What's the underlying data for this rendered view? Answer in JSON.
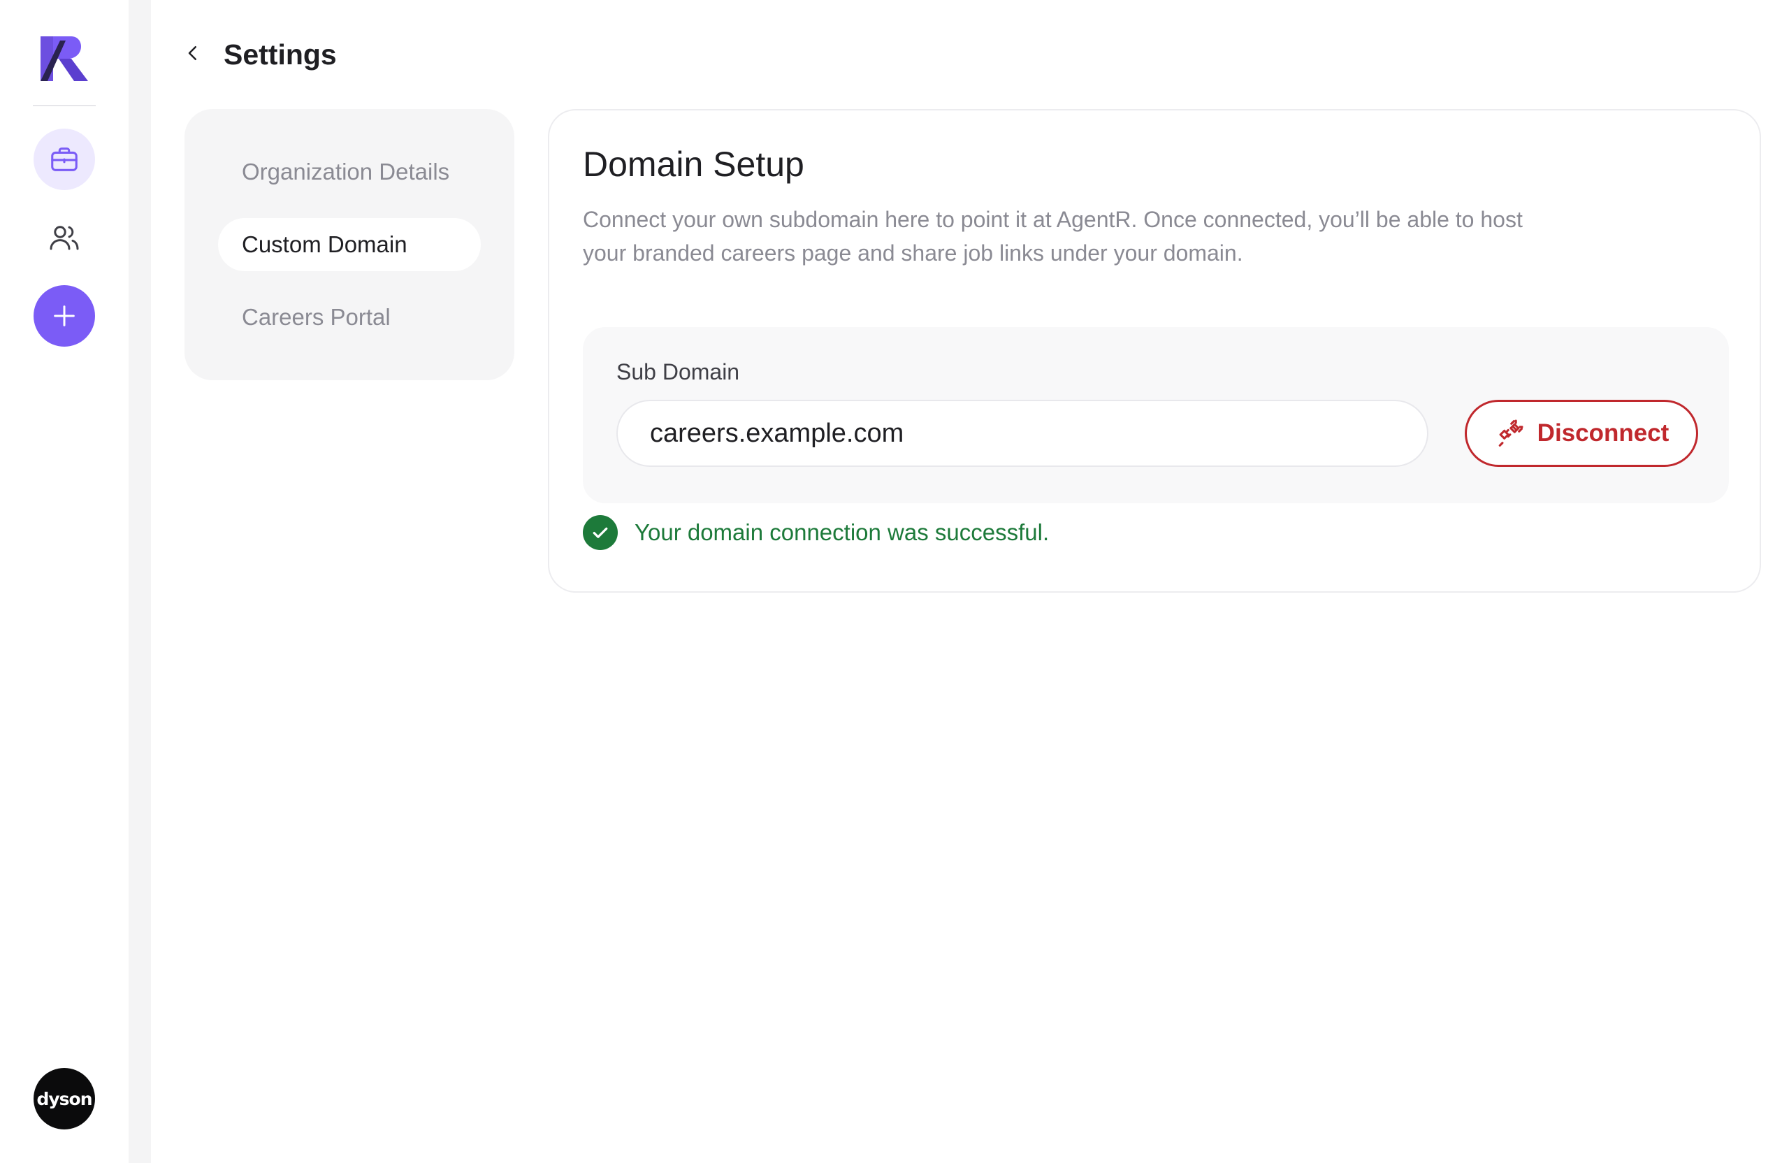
{
  "app": {
    "logo_icon": "agentr-k-logo-icon",
    "brand_color": "#7b5cf6"
  },
  "rail": {
    "items": [
      {
        "name": "jobs",
        "icon": "briefcase-icon",
        "active": true
      },
      {
        "name": "people",
        "icon": "users-icon",
        "active": false
      },
      {
        "name": "add",
        "icon": "plus-icon",
        "active": false
      }
    ],
    "avatar_label": "dyson"
  },
  "header": {
    "back_icon": "chevron-left-icon",
    "title": "Settings"
  },
  "settings_nav": {
    "items": [
      {
        "label": "Organization Details",
        "active": false
      },
      {
        "label": "Custom Domain",
        "active": true
      },
      {
        "label": "Careers Portal",
        "active": false
      }
    ]
  },
  "domain_setup": {
    "title": "Domain Setup",
    "description": "Connect your own subdomain here to point it at AgentR. Once connected, you’ll be able to host your branded careers page and share job links under your domain.",
    "field_label": "Sub Domain",
    "domain_value": "careers.example.com",
    "disconnect_label": "Disconnect",
    "disconnect_icon": "unlink-icon",
    "disconnect_color": "#c0282d",
    "status_icon": "check-circle-icon",
    "status_text": "Your domain connection was successful.",
    "status_color": "#1d7a3a"
  }
}
